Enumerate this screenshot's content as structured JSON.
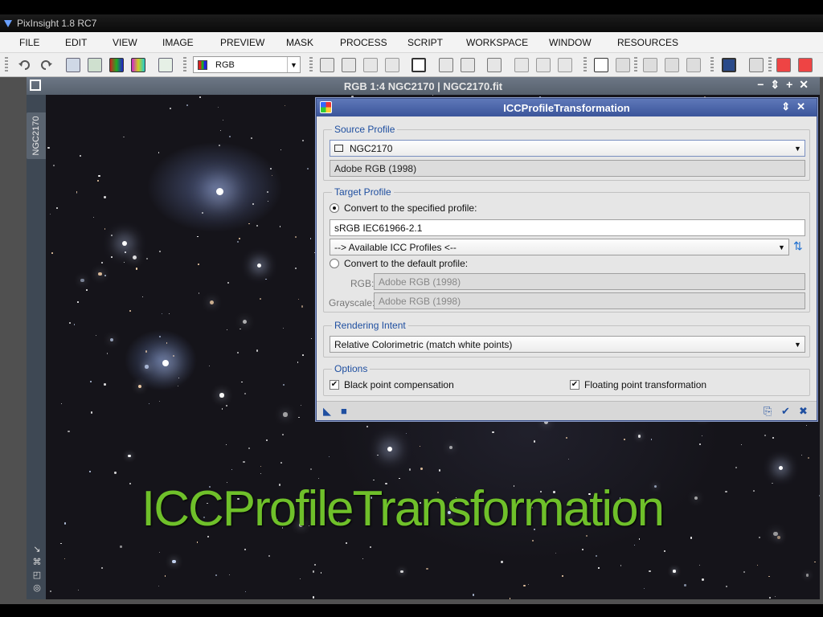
{
  "app": {
    "title": "PixInsight 1.8 RC7"
  },
  "menu": [
    "FILE",
    "EDIT",
    "VIEW",
    "IMAGE",
    "PREVIEW",
    "MASK",
    "PROCESS",
    "SCRIPT",
    "WORKSPACE",
    "WINDOW",
    "RESOURCES"
  ],
  "toolbar": {
    "channel_select": "RGB"
  },
  "image_window": {
    "title": "RGB 1:4 NGC2170 | NGC2170.fit",
    "side_tab": "NGC2170"
  },
  "dialog": {
    "title": "ICCProfileTransformation",
    "source_profile": {
      "label": "Source Profile",
      "view": "NGC2170",
      "profile": "Adobe RGB (1998)"
    },
    "target_profile": {
      "label": "Target Profile",
      "convert_specified_label": "Convert to the specified profile:",
      "specified_profile": "sRGB IEC61966-2.1",
      "available_profiles": "--> Available ICC Profiles <--",
      "convert_default_label": "Convert to the default profile:",
      "rgb_label": "RGB:",
      "rgb_value": "Adobe RGB (1998)",
      "grayscale_label": "Grayscale:",
      "grayscale_value": "Adobe RGB (1998)",
      "selected": "specified"
    },
    "rendering_intent": {
      "label": "Rendering Intent",
      "value": "Relative Colorimetric (match white points)"
    },
    "options": {
      "label": "Options",
      "black_point_label": "Black point compensation",
      "black_point_checked": true,
      "floating_point_label": "Floating point transformation",
      "floating_point_checked": true
    }
  },
  "overlay_caption": "ICCProfileTransformation",
  "colors": {
    "dialog_title": "#3b559a",
    "group_label": "#1f4fa0",
    "caption": "#6fc02a"
  }
}
